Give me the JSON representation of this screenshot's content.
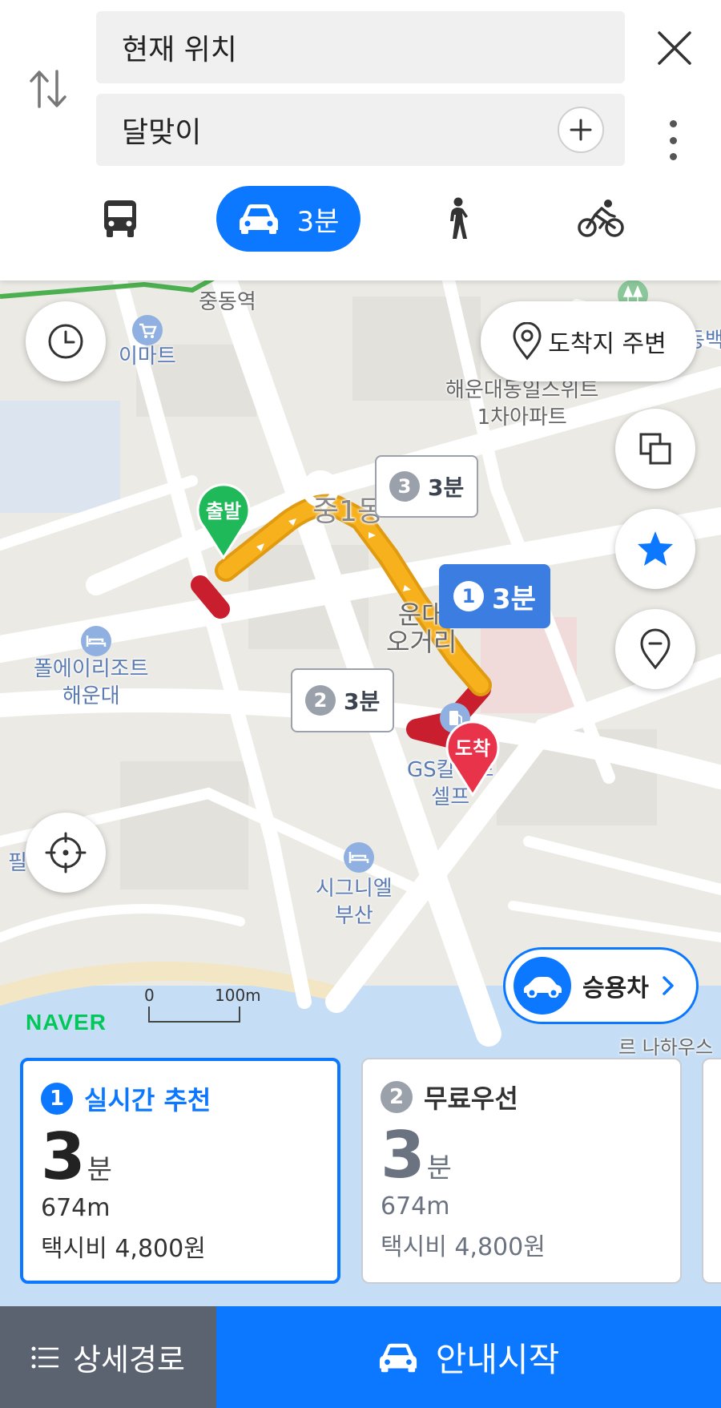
{
  "search": {
    "origin": "현재 위치",
    "destination": "달맞이"
  },
  "modes": {
    "car_time": "3분"
  },
  "map": {
    "labels": {
      "station": "중동역",
      "emart": "이마트",
      "apartment_line1": "해운대동일스위트",
      "apartment_line2": "1차아파트",
      "district": "중1동",
      "crossroad_line1": "운대",
      "crossroad_line2": "오거리",
      "resort_line1": "폴에이리조트",
      "resort_line2": "해운대",
      "gas_line1": "GS칼텍스",
      "gas_line2": "셀프",
      "hotel_line1": "시그니엘",
      "hotel_line2": "부산",
      "edge_left": "필",
      "edge_right_top": "동백",
      "edge_bottom_right": "르 나하우스"
    },
    "near_destination_label": "도착지 주변",
    "start_pin": "출발",
    "end_pin": "도착",
    "bubbles": [
      {
        "num": "1",
        "time": "3분"
      },
      {
        "num": "2",
        "time": "3분"
      },
      {
        "num": "3",
        "time": "3분"
      }
    ],
    "scale": {
      "zero": "0",
      "distance": "100m"
    },
    "logo": "NAVER",
    "vehicle_type": "승용차"
  },
  "routes": [
    {
      "num": "1",
      "title": "실시간 추천",
      "time": "3",
      "unit": "분",
      "distance": "674m",
      "fare": "택시비 4,800원"
    },
    {
      "num": "2",
      "title": "무료우선",
      "time": "3",
      "unit": "분",
      "distance": "674m",
      "fare": "택시비 4,800원"
    }
  ],
  "footer": {
    "detail_label": "상세경로",
    "start_label": "안내시작"
  },
  "colors": {
    "accent": "#0b78ff",
    "route": "#f7b11d",
    "start_pin": "#1fb95a",
    "end_pin": "#e8334a"
  }
}
